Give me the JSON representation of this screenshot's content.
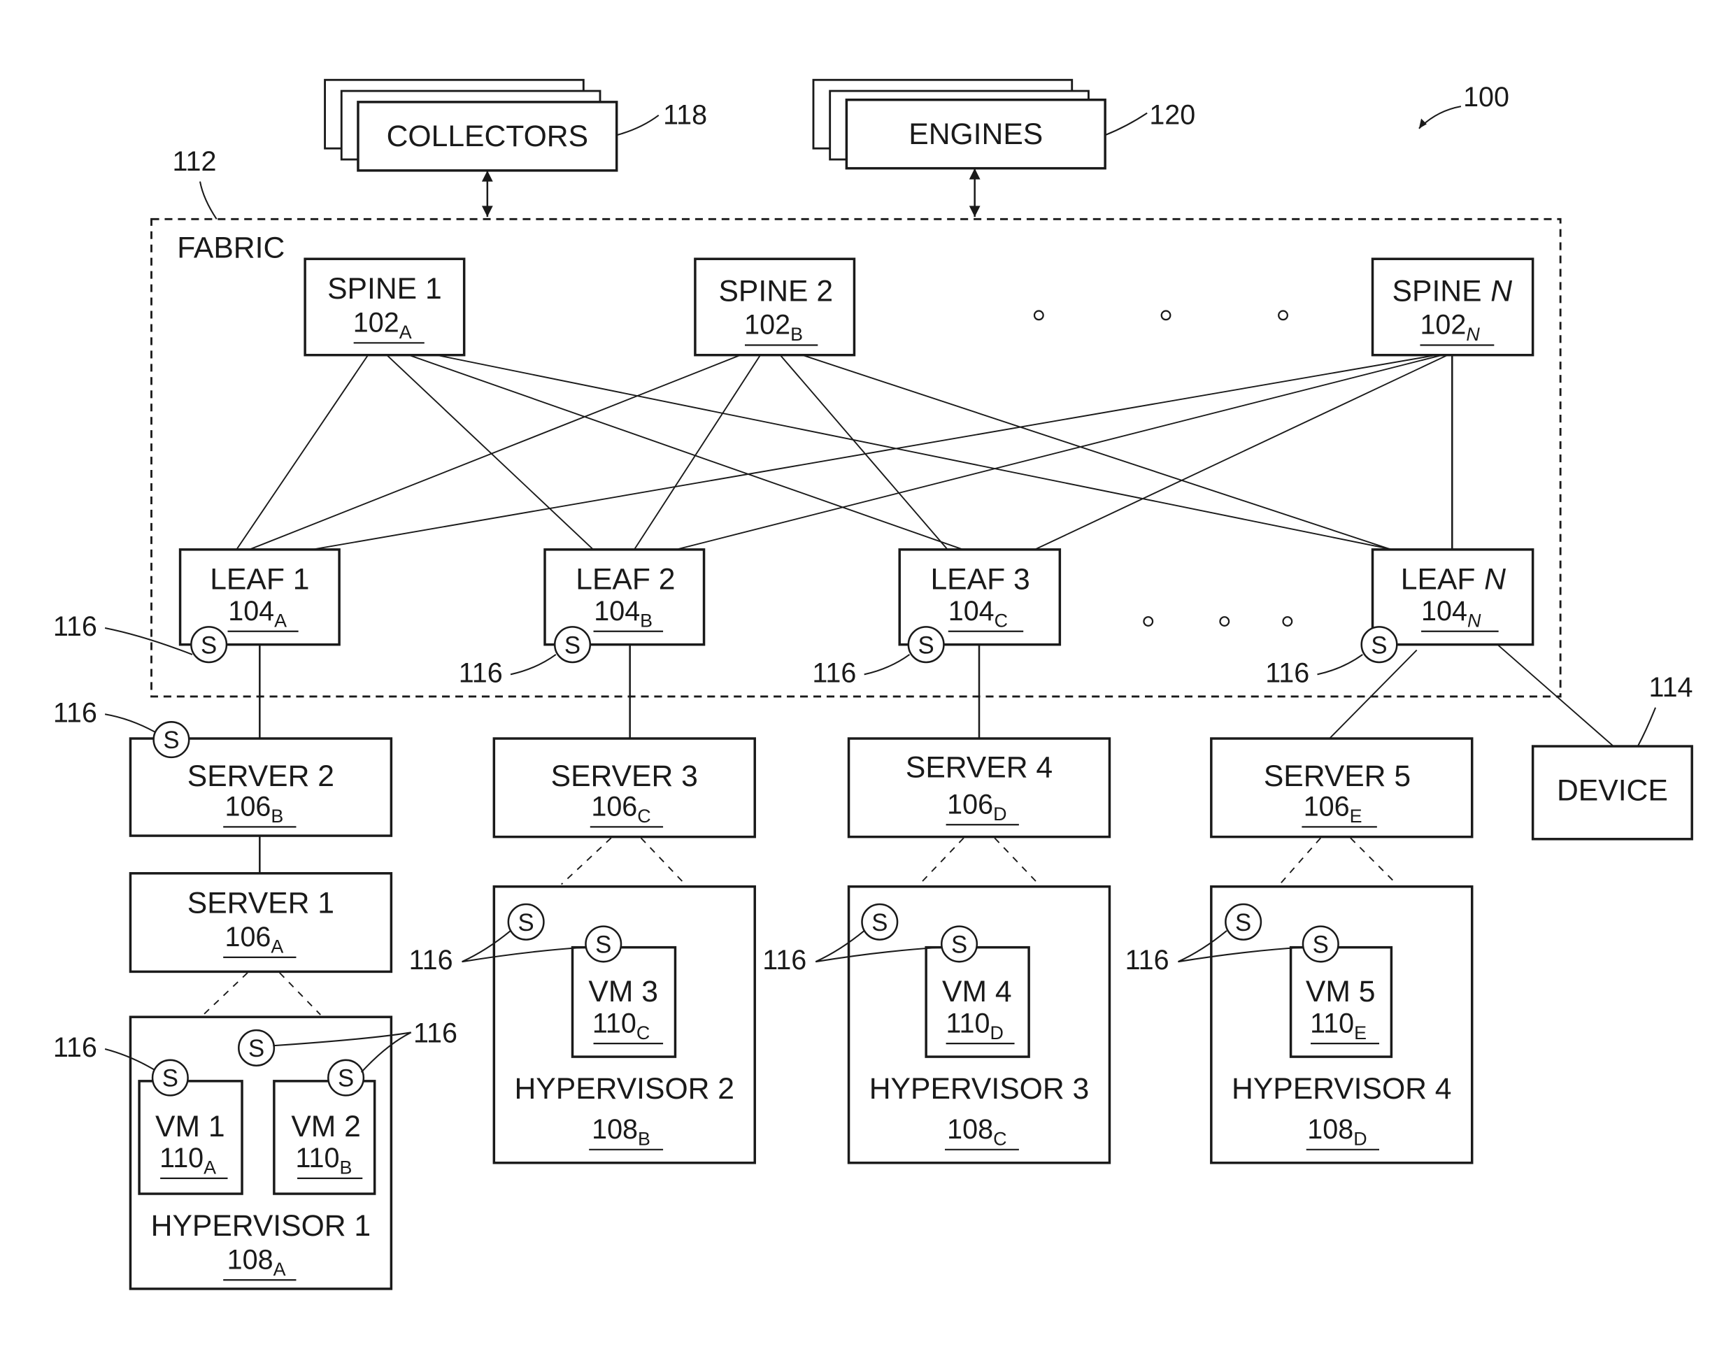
{
  "figure": {
    "ref": "100",
    "fabric": {
      "label": "FABRIC",
      "ref": "112"
    },
    "collectors": {
      "label": "COLLECTORS",
      "ref": "118"
    },
    "engines": {
      "label": "ENGINES",
      "ref": "120"
    },
    "sensor_glyph": "S",
    "sensor_ref": "116",
    "ellipsis_glyph": "o",
    "spines": [
      {
        "name": "SPINE 1",
        "ref": "102",
        "sub": "A"
      },
      {
        "name": "SPINE 2",
        "ref": "102",
        "sub": "B"
      },
      {
        "name": "SPINE",
        "name_suffix_italic": "N",
        "ref": "102",
        "sub": "N"
      }
    ],
    "leaves": [
      {
        "name": "LEAF 1",
        "ref": "104",
        "sub": "A"
      },
      {
        "name": "LEAF 2",
        "ref": "104",
        "sub": "B"
      },
      {
        "name": "LEAF 3",
        "ref": "104",
        "sub": "C"
      },
      {
        "name": "LEAF",
        "name_suffix_italic": "N",
        "ref": "104",
        "sub": "N"
      }
    ],
    "servers": [
      {
        "name": "SERVER 1",
        "ref": "106",
        "sub": "A"
      },
      {
        "name": "SERVER 2",
        "ref": "106",
        "sub": "B"
      },
      {
        "name": "SERVER 3",
        "ref": "106",
        "sub": "C"
      },
      {
        "name": "SERVER 4",
        "ref": "106",
        "sub": "D"
      },
      {
        "name": "SERVER 5",
        "ref": "106",
        "sub": "E"
      }
    ],
    "hypervisors": [
      {
        "name": "HYPERVISOR 1",
        "ref": "108",
        "sub": "A"
      },
      {
        "name": "HYPERVISOR 2",
        "ref": "108",
        "sub": "B"
      },
      {
        "name": "HYPERVISOR 3",
        "ref": "108",
        "sub": "C"
      },
      {
        "name": "HYPERVISOR 4",
        "ref": "108",
        "sub": "D"
      }
    ],
    "vms": [
      {
        "name": "VM 1",
        "ref": "110",
        "sub": "A"
      },
      {
        "name": "VM 2",
        "ref": "110",
        "sub": "B"
      },
      {
        "name": "VM 3",
        "ref": "110",
        "sub": "C"
      },
      {
        "name": "VM 4",
        "ref": "110",
        "sub": "D"
      },
      {
        "name": "VM 5",
        "ref": "110",
        "sub": "E"
      }
    ],
    "device": {
      "label": "DEVICE",
      "ref": "114"
    }
  }
}
